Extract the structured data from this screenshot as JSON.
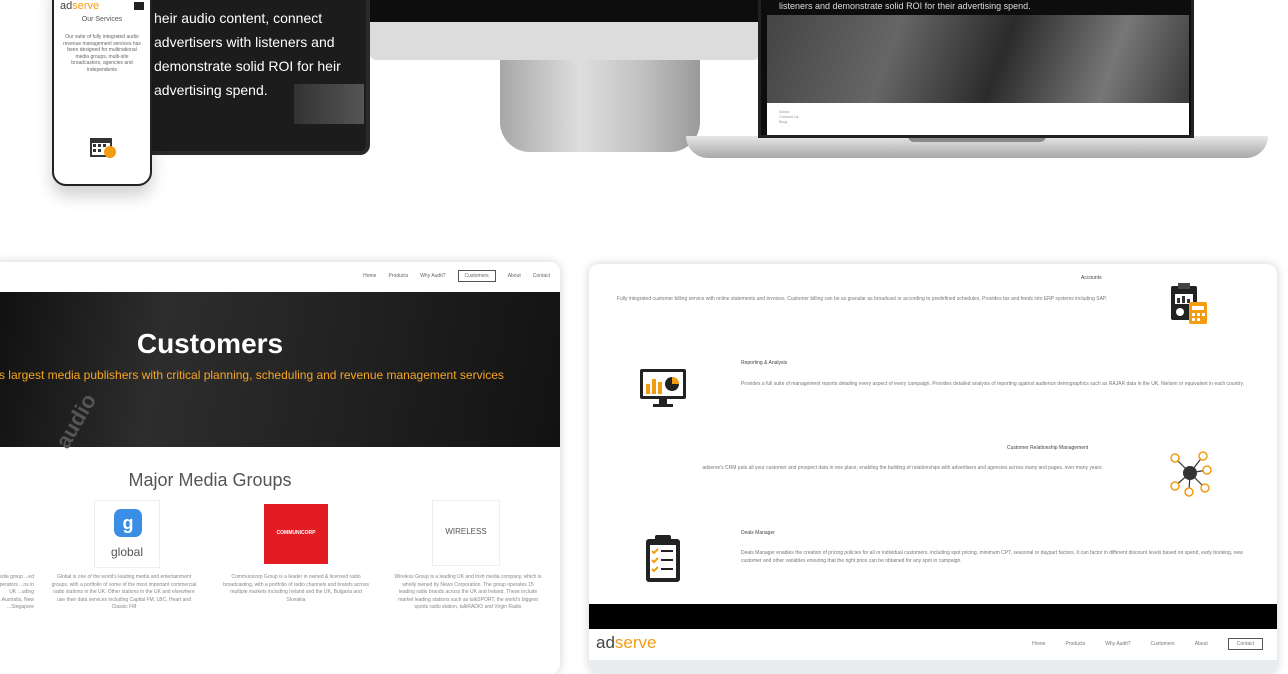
{
  "top": {
    "phone": {
      "logo_ad": "ad",
      "logo_serve": "serve",
      "services_title": "Our Services",
      "services_text": "Our suite of fully integrated audio revenue management services has been designed for multinational media groups, multi-site broadcasters, agencies and independents"
    },
    "tablet_text": "heir audio content, connect advertisers with listeners and demonstrate solid ROI for heir advertising spend.",
    "laptop_text": "listeners and demonstrate solid ROI for their advertising spend."
  },
  "left_site": {
    "nav": [
      "Home",
      "Products",
      "Why Audit?",
      "Customers",
      "About",
      "Contact"
    ],
    "nav_selected": "Customers",
    "hero_title": "Customers",
    "hero_subtitle": "e's largest media publishers with critical planning, scheduling and revenue management services",
    "section_title": "Major Media Groups",
    "logos": {
      "global_letter": "g",
      "global_text": "global",
      "commcorp_text": "COMMUNICORP",
      "wireless_text": "WIRELESS"
    },
    "descriptions": [
      "...media group ...ed operators ...ns in UK ...uding ...Australia, New ...Singapore",
      "Global is one of the world's leading media and entertainment groups, with a portfolio of some of the most important commercial radio stations in the UK. Other stations in the UK and elsewhere use their data services including Capital FM, LBC, Heart and Classic FM",
      "Communicorp Group is a leader in owned & licensed radio broadcasting, with a portfolio of radio channels and brands across multiple markets including Ireland and the UK, Bulgaria and Slovakia",
      "Wireless Group is a leading UK and Irish media company, which is wholly owned by News Corporation. The group operates 15 leading radio brands across the UK and Ireland. These include market leading stations such as talkSPORT, the world's biggest sports radio station, talkRADIO and Virgin Radio"
    ]
  },
  "right_site": {
    "features": [
      {
        "title": "Accounts",
        "text": "Fully integrated customer billing service with online statements and invoices. Customer billing can be as granular as broadcast or according to predefined schedules. Provides tax and feeds into ERP systems including SAP."
      },
      {
        "title": "Reporting & Analysis",
        "text": "Provides a full suite of management reports detailing every aspect of every campaign. Provides detailed analysis of reporting against audience demographics such as RAJAR data in the UK, Nielsen or equivalent in each country."
      },
      {
        "title": "Customer Relationship Management",
        "text": "adserve's CRM puts all your customer and prospect data in one place, enabling the building of relationships with advertisers and agencies across many and pages, over many years."
      },
      {
        "title": "Deals Manager",
        "text": "Deals Manager enables the creation of pricing policies for all or individual customers, including spot pricing, minimum CPT, seasonal or daypart factors. It can factor in different discount levels based on spend, early booking, new customer and other variables ensuring that the right price can be obtained for any spot in campaign."
      }
    ],
    "footer_logo_ad": "ad",
    "footer_logo_serve": "serve",
    "footer_nav": [
      "Home",
      "Products",
      "Why Audit?",
      "Customers",
      "About",
      "Contact"
    ]
  },
  "colors": {
    "accent": "#f39c12",
    "hero_sub": "#f5a623",
    "commcorp_red": "#e31b23",
    "global_blue": "#3a8ee6"
  },
  "icons": [
    "calendar-icon",
    "accounts-icon",
    "reporting-monitor-icon",
    "crm-network-icon",
    "deals-clipboard-icon"
  ]
}
